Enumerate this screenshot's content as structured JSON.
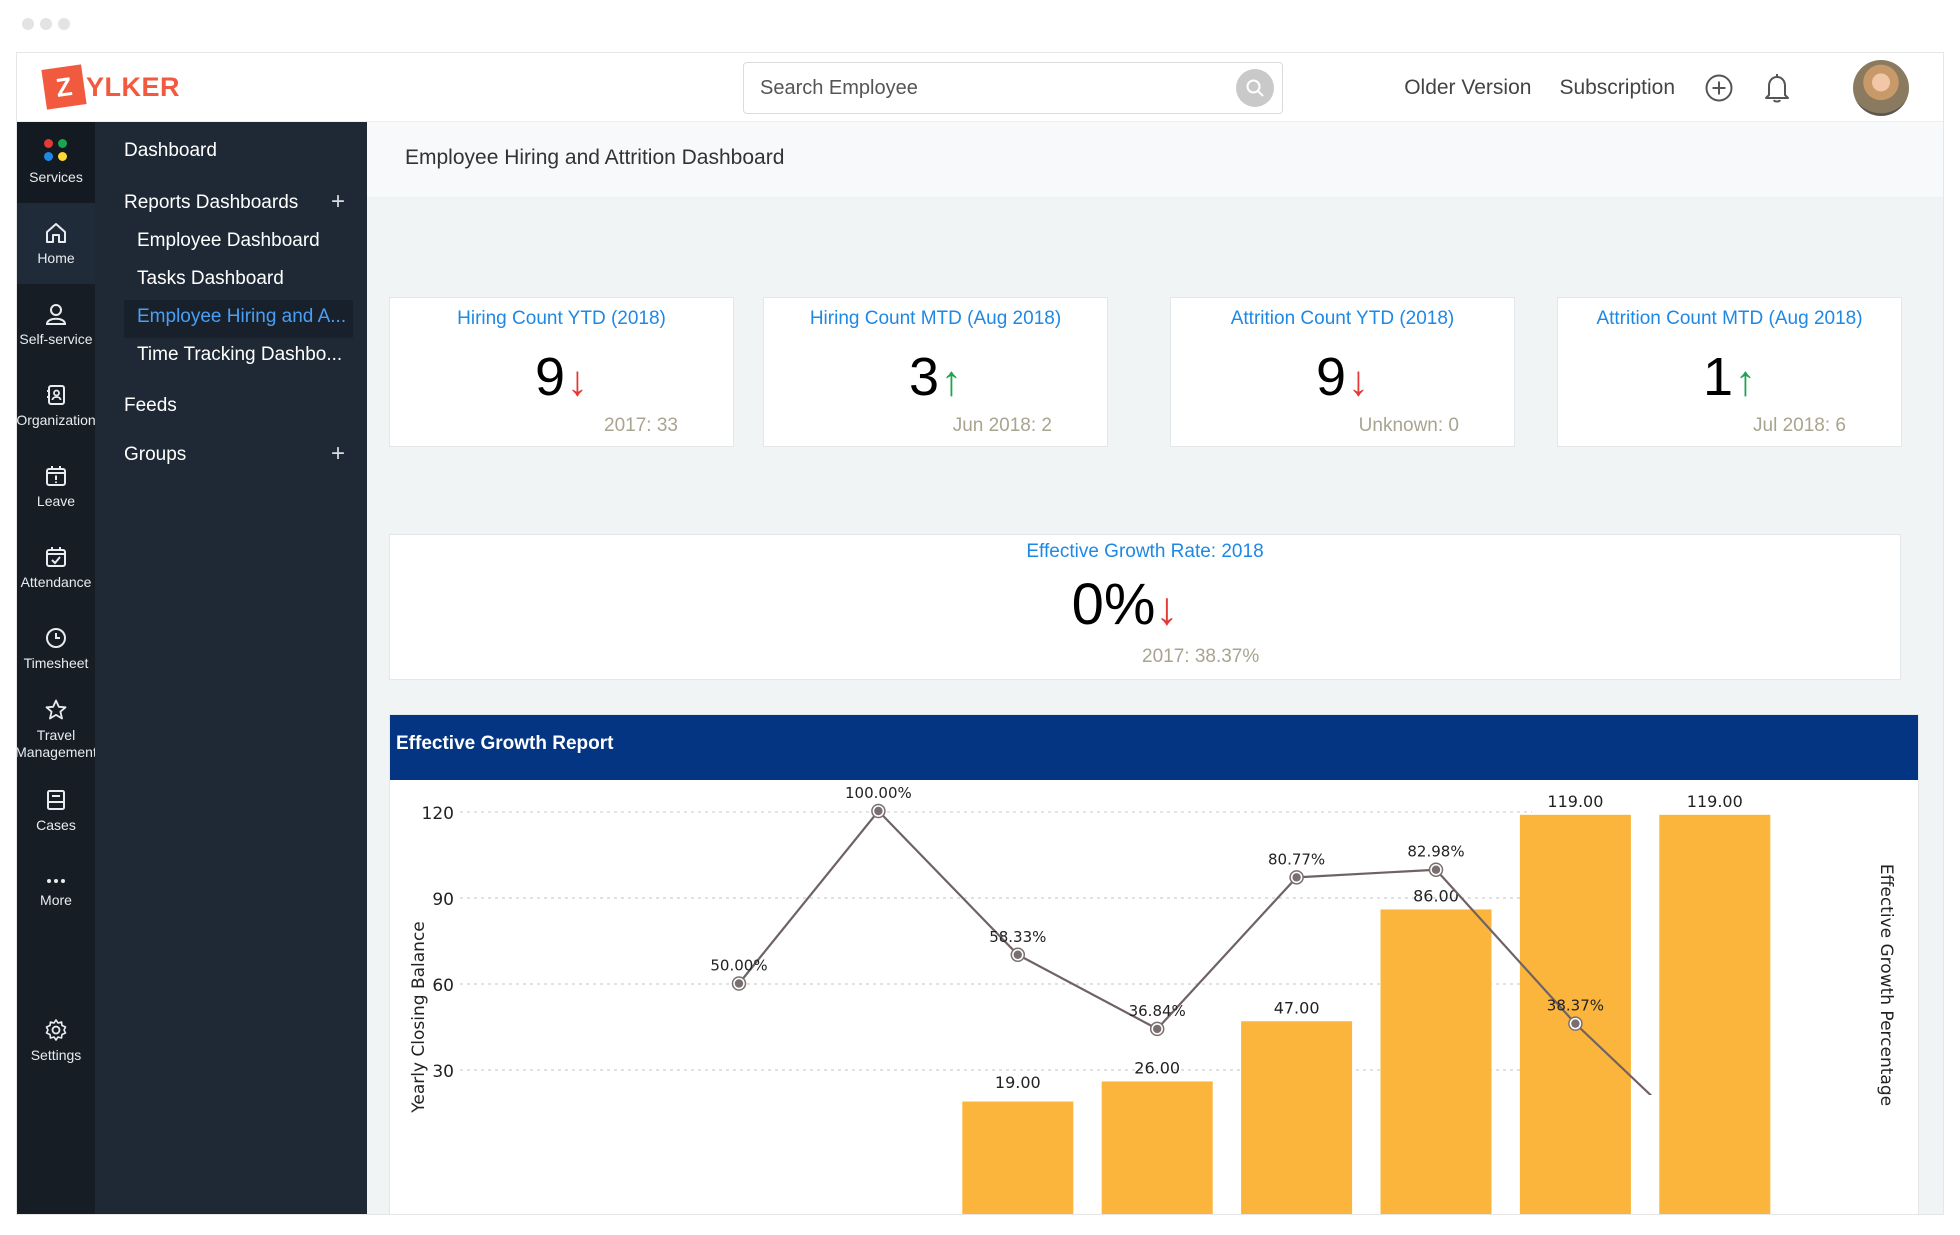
{
  "app": {
    "logo_letter": "Z",
    "logo_rest": "YLKER",
    "brand_color": "#f25a3f"
  },
  "header": {
    "search_placeholder": "Search Employee",
    "search_icon": "search-icon",
    "links": [
      "Older Version",
      "Subscription"
    ],
    "icons": [
      "plus-circle-icon",
      "bell-icon",
      "avatar"
    ]
  },
  "rail": {
    "items": [
      {
        "label": "Services",
        "icon": "services-icon"
      },
      {
        "label": "Home",
        "icon": "home-icon",
        "active": true
      },
      {
        "label": "Self-service",
        "icon": "user-icon"
      },
      {
        "label": "Organization",
        "icon": "contact-book-icon"
      },
      {
        "label": "Leave",
        "icon": "calendar-alert-icon"
      },
      {
        "label": "Attendance",
        "icon": "calendar-check-icon"
      },
      {
        "label": "Timesheet",
        "icon": "clock-icon"
      },
      {
        "label": "Travel",
        "label2": "Management",
        "icon": "star-icon"
      },
      {
        "label": "Cases",
        "icon": "inbox-icon"
      },
      {
        "label": "More",
        "icon": "more-icon"
      },
      {
        "label": "Settings",
        "icon": "gear-icon"
      }
    ]
  },
  "panel": {
    "dashboard": "Dashboard",
    "reports_dashboards": "Reports Dashboards",
    "sub_items": [
      "Employee Dashboard",
      "Tasks Dashboard",
      "Employee Hiring and A...",
      "Time Tracking Dashbo..."
    ],
    "selected_index": 2,
    "feeds": "Feeds",
    "groups": "Groups",
    "plus": "+"
  },
  "main": {
    "page_title": "Employee Hiring and Attrition Dashboard",
    "cards": [
      {
        "title": "Hiring Count YTD (2018)",
        "value": "9",
        "trend": "down",
        "arrow": "↓",
        "compare": "2017: 33"
      },
      {
        "title": "Hiring Count MTD (Aug 2018)",
        "value": "3",
        "trend": "up",
        "arrow": "↑",
        "compare": "Jun 2018: 2"
      },
      {
        "title": "Attrition Count YTD (2018)",
        "value": "9",
        "trend": "down",
        "arrow": "↓",
        "compare": "Unknown: 0"
      },
      {
        "title": "Attrition Count MTD (Aug 2018)",
        "value": "1",
        "trend": "up",
        "arrow": "↑",
        "compare": "Jul 2018: 6"
      }
    ],
    "growth": {
      "title": "Effective Growth Rate: 2018",
      "value": "0%",
      "trend": "down",
      "arrow": "↓",
      "compare": "2017: 38.37%"
    },
    "report_title": "Effective Growth Report"
  },
  "colors": {
    "down": "#e53935",
    "up": "#1aa551",
    "card_title": "#1e88e5",
    "report_header": "#043582",
    "bar": "#fbb53c",
    "line": "#6f6264"
  },
  "chart_data": {
    "type": "bar",
    "title": "Effective Growth Report",
    "xlabel": "",
    "ylabel": "Yearly Closing Balance",
    "y2label": "Effective Growth Percentage",
    "ylim": [
      0,
      120
    ],
    "y_ticks": [
      30,
      60,
      90,
      120
    ],
    "y2lim": [
      0,
      100
    ],
    "y2_ticks": [
      "20%",
      "40%",
      "60%",
      "80%"
    ],
    "y2_tick_values": [
      20,
      40,
      60,
      80
    ],
    "grid": true,
    "note": "x-axis category labels not visible (chart scrolled/clipped)",
    "series": [
      {
        "name": "Yearly Closing Balance",
        "type": "bar",
        "axis": "left",
        "values": [
          null,
          null,
          19,
          26,
          47,
          86,
          119,
          119
        ],
        "labels": [
          "",
          "",
          "19.00",
          "26.00",
          "47.00",
          "86.00",
          "119.00",
          "119.00"
        ]
      },
      {
        "name": "Effective Growth Percentage",
        "type": "line",
        "axis": "right",
        "values": [
          50.0,
          100.0,
          58.33,
          36.84,
          80.77,
          82.98,
          38.37,
          0
        ],
        "labels": [
          "50.00%",
          "100.00%",
          "58.33%",
          "36.84%",
          "80.77%",
          "82.98%",
          "38.37%",
          ""
        ]
      }
    ]
  }
}
